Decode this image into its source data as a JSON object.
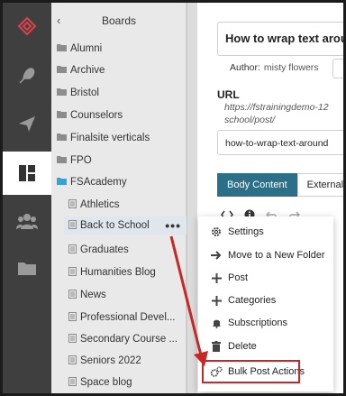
{
  "rail": {
    "items": [
      {
        "name": "logo-icon"
      },
      {
        "name": "feather-icon"
      },
      {
        "name": "send-icon"
      },
      {
        "name": "dashboard-icon"
      },
      {
        "name": "group-icon"
      },
      {
        "name": "folder-icon"
      }
    ],
    "active": "dashboard-icon"
  },
  "boards": {
    "back": "‹",
    "title": "Boards",
    "items": [
      {
        "label": "Alumni"
      },
      {
        "label": "Archive"
      },
      {
        "label": "Bristol"
      },
      {
        "label": "Counselors"
      },
      {
        "label": "Finalsite verticals"
      },
      {
        "label": "FPO"
      },
      {
        "label": "FSAcademy"
      },
      {
        "label": "Athletics"
      },
      {
        "label": "Back to School"
      },
      {
        "label": "Graduates"
      },
      {
        "label": "Humanities Blog"
      },
      {
        "label": "News"
      },
      {
        "label": "Professional Devel..."
      },
      {
        "label": "Secondary Course ..."
      },
      {
        "label": "Seniors 2022"
      },
      {
        "label": "Space blog"
      }
    ],
    "more": "•••"
  },
  "editor": {
    "title_value": "How to wrap text arou",
    "author_label": "Author:",
    "author_value": "misty flowers",
    "url_label": "URL",
    "url_line1": "https://fstrainingdemo-12",
    "url_line2": "school/post/",
    "slug_value": "how-to-wrap-text-around",
    "tab_body": "Body Content",
    "tab_external": "External"
  },
  "menu": {
    "items": [
      {
        "label": "Settings",
        "icon": "gear-icon"
      },
      {
        "label": "Move to a New Folder",
        "icon": "arrow-right-icon"
      },
      {
        "label": "Post",
        "icon": "plus-icon"
      },
      {
        "label": "Categories",
        "icon": "plus-icon"
      },
      {
        "label": "Subscriptions",
        "icon": "bell-icon"
      },
      {
        "label": "Delete",
        "icon": "trash-icon"
      },
      {
        "label": "Bulk Post Actions",
        "icon": "gears-icon"
      }
    ]
  },
  "colors": {
    "accent": "#2b6f88",
    "highlight": "#c62828",
    "folder_open": "#3aa0d8"
  }
}
